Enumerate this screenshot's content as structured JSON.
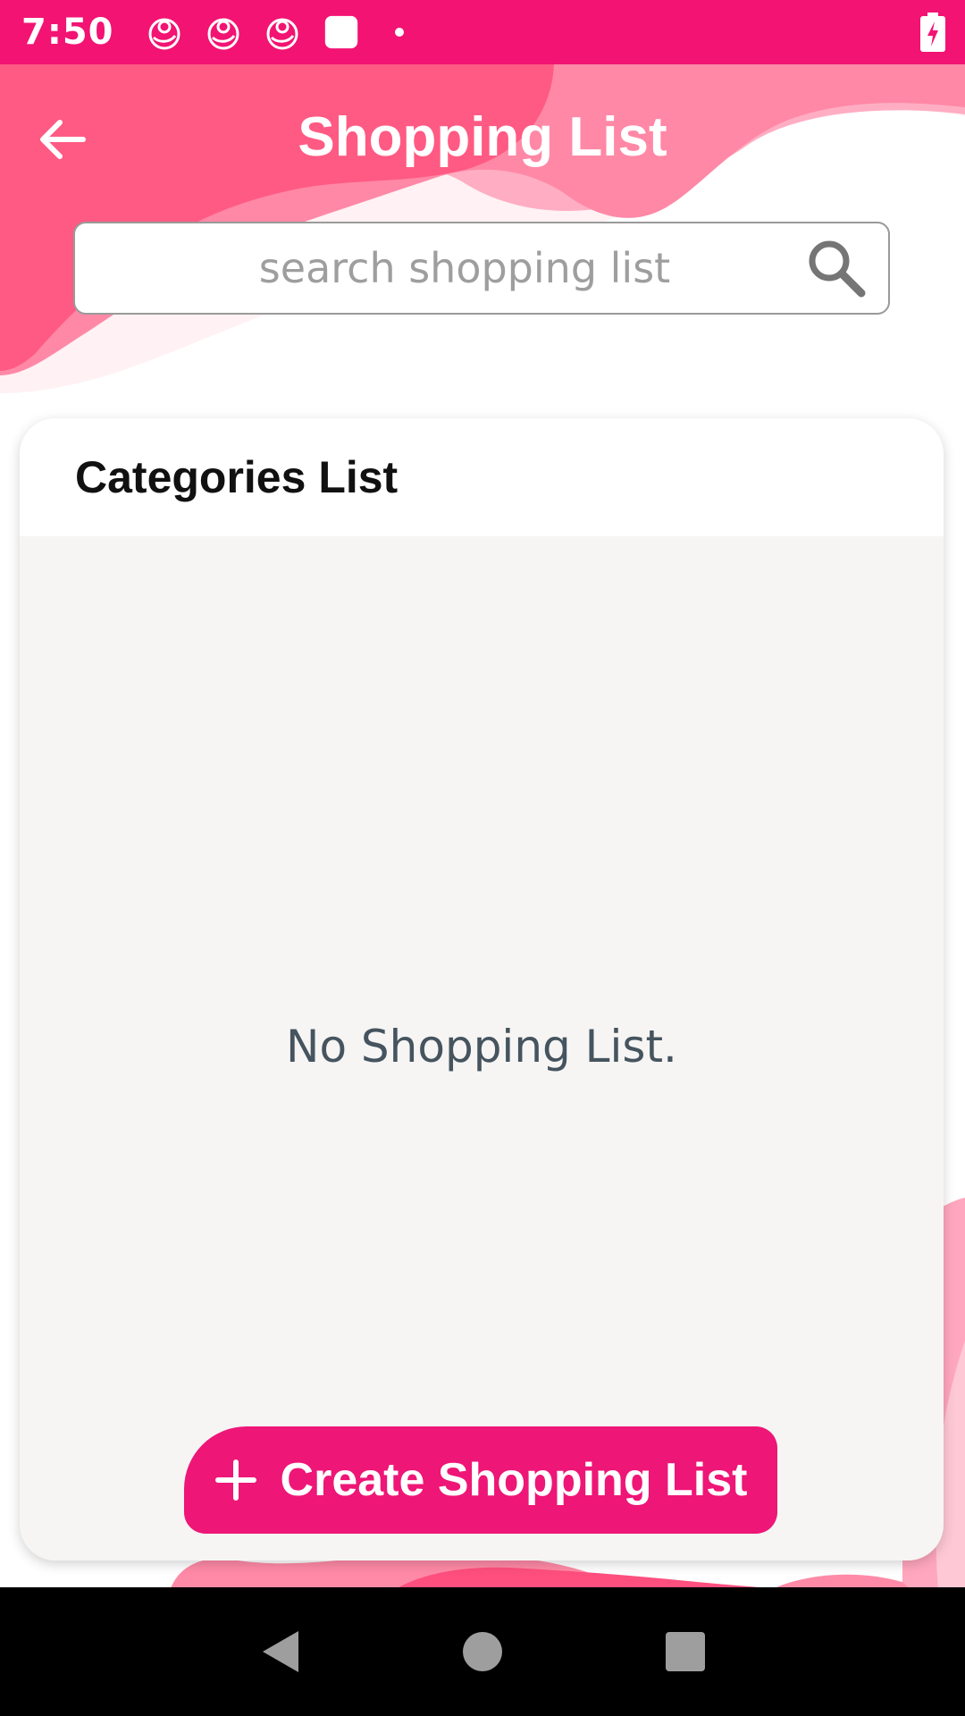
{
  "status_bar": {
    "time": "7:50",
    "icons": [
      "app-notification-icon",
      "app-notification-icon",
      "app-notification-icon",
      "square-notification-icon",
      "dot-icon"
    ],
    "battery_icon": "battery-charging-icon"
  },
  "header": {
    "title": "Shopping List",
    "back_icon": "arrow-back-icon"
  },
  "search": {
    "placeholder": "search shopping list",
    "value": "",
    "icon": "search-icon"
  },
  "card": {
    "title": "Categories List",
    "empty_message": "No Shopping List.",
    "create_button_label": "Create Shopping List",
    "create_button_icon": "plus-icon"
  },
  "nav": {
    "back": "nav-back-icon",
    "home": "nav-home-icon",
    "recents": "nav-recents-icon"
  },
  "colors": {
    "accent": "#f21373",
    "button": "#ee1677",
    "wave_dark": "#ff4f7e",
    "wave_light": "#ff8aa7",
    "card_bg": "#f6f5f4",
    "empty_text": "#45545e"
  }
}
